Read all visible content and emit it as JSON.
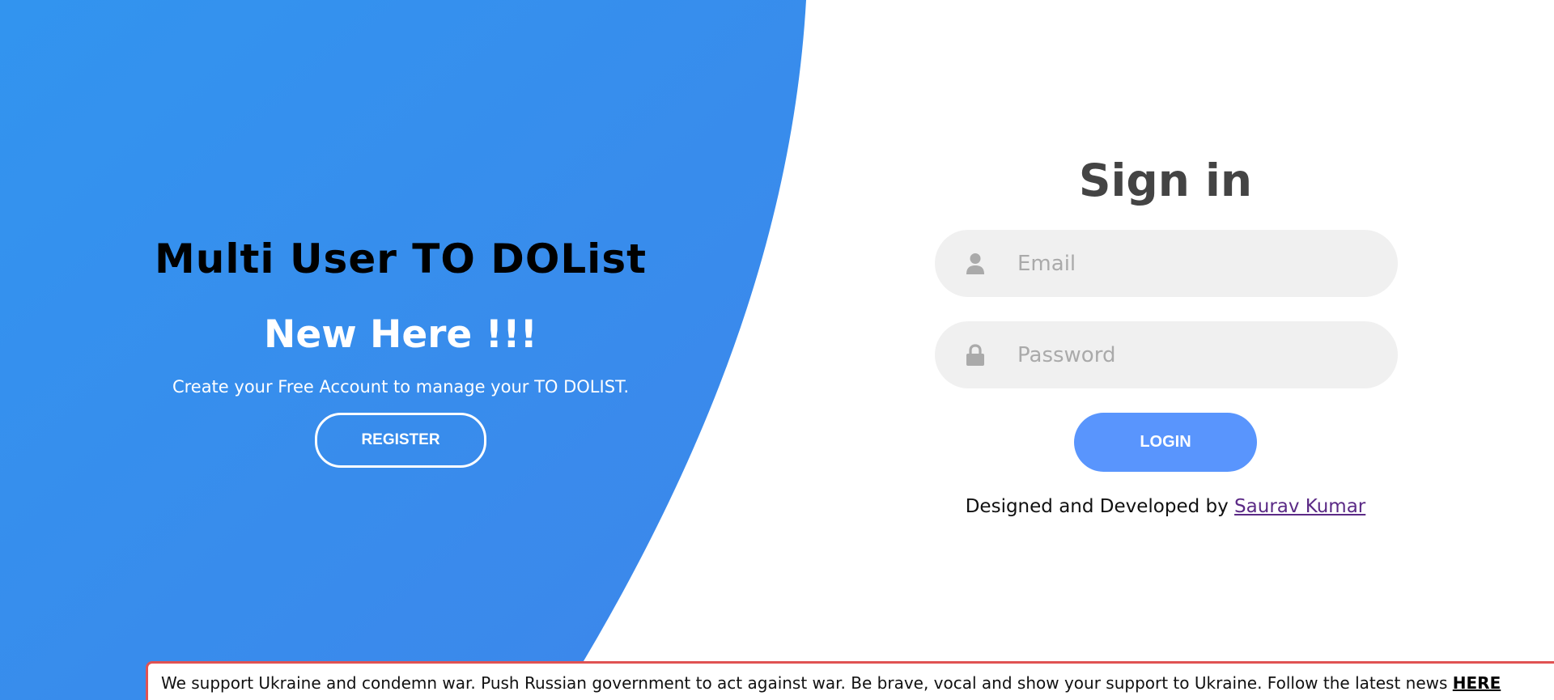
{
  "colors": {
    "blue_start": "#3294ef",
    "blue_end": "#3d86ea",
    "login_button": "#5995fd",
    "input_bg": "#f0f0f0",
    "banner_border": "#e05252"
  },
  "left": {
    "app_title": "Multi User TO DOList",
    "heading": "New Here !!!",
    "subtext": "Create your Free Account to manage your TO DOLIST.",
    "register_label": "REGISTER"
  },
  "signin": {
    "title": "Sign in",
    "email": {
      "placeholder": "Email",
      "icon": "user-icon"
    },
    "password": {
      "placeholder": "Password",
      "icon": "lock-icon"
    },
    "login_label": "LOGIN",
    "credit_prefix": "Designed and Developed by ",
    "credit_name": "Saurav Kumar"
  },
  "banner": {
    "text": "We support Ukraine and condemn war. Push Russian government to act against war. Be brave, vocal and show your support to Ukraine. Follow the latest news ",
    "link_label": "HERE"
  }
}
